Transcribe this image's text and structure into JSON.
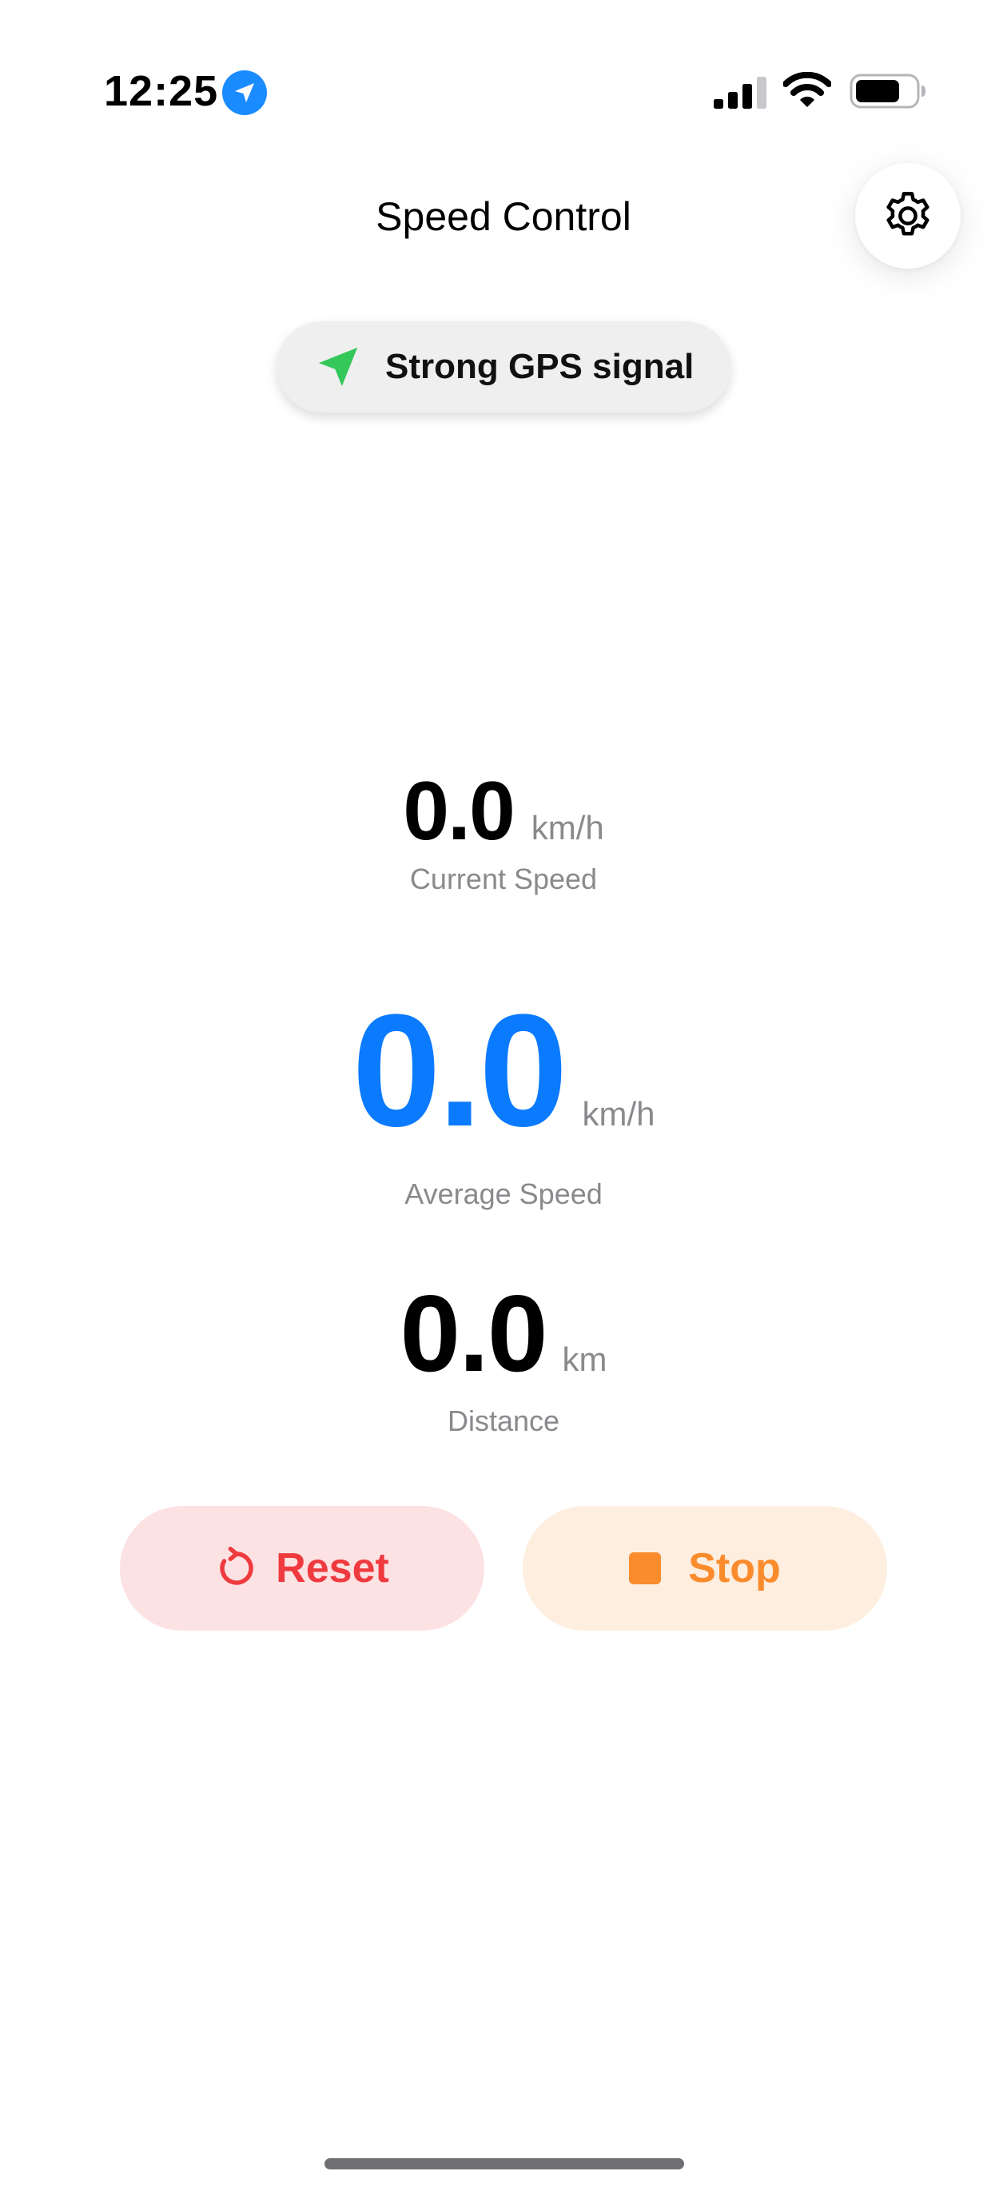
{
  "status_bar": {
    "time": "12:25",
    "icons": [
      "location-arrow-icon",
      "cellular-signal-icon",
      "wifi-icon",
      "battery-icon"
    ]
  },
  "header": {
    "title": "Speed Control",
    "settings_icon": "gear-icon"
  },
  "gps": {
    "status_text": "Strong GPS signal",
    "icon": "location-arrow-icon",
    "icon_color": "#34c759"
  },
  "metrics": {
    "current": {
      "value": "0.0",
      "unit": "km/h",
      "label": "Current Speed"
    },
    "average": {
      "value": "0.0",
      "unit": "km/h",
      "label": "Average Speed",
      "color": "#0a7aff"
    },
    "distance": {
      "value": "0.0",
      "unit": "km",
      "label": "Distance"
    }
  },
  "actions": {
    "reset": {
      "label": "Reset",
      "icon": "reset-arrow-icon",
      "color": "#ef3a3f",
      "background": "#fde2e3"
    },
    "stop": {
      "label": "Stop",
      "icon": "stop-square-icon",
      "color": "#fa8c2d",
      "background": "#feeedf"
    }
  }
}
